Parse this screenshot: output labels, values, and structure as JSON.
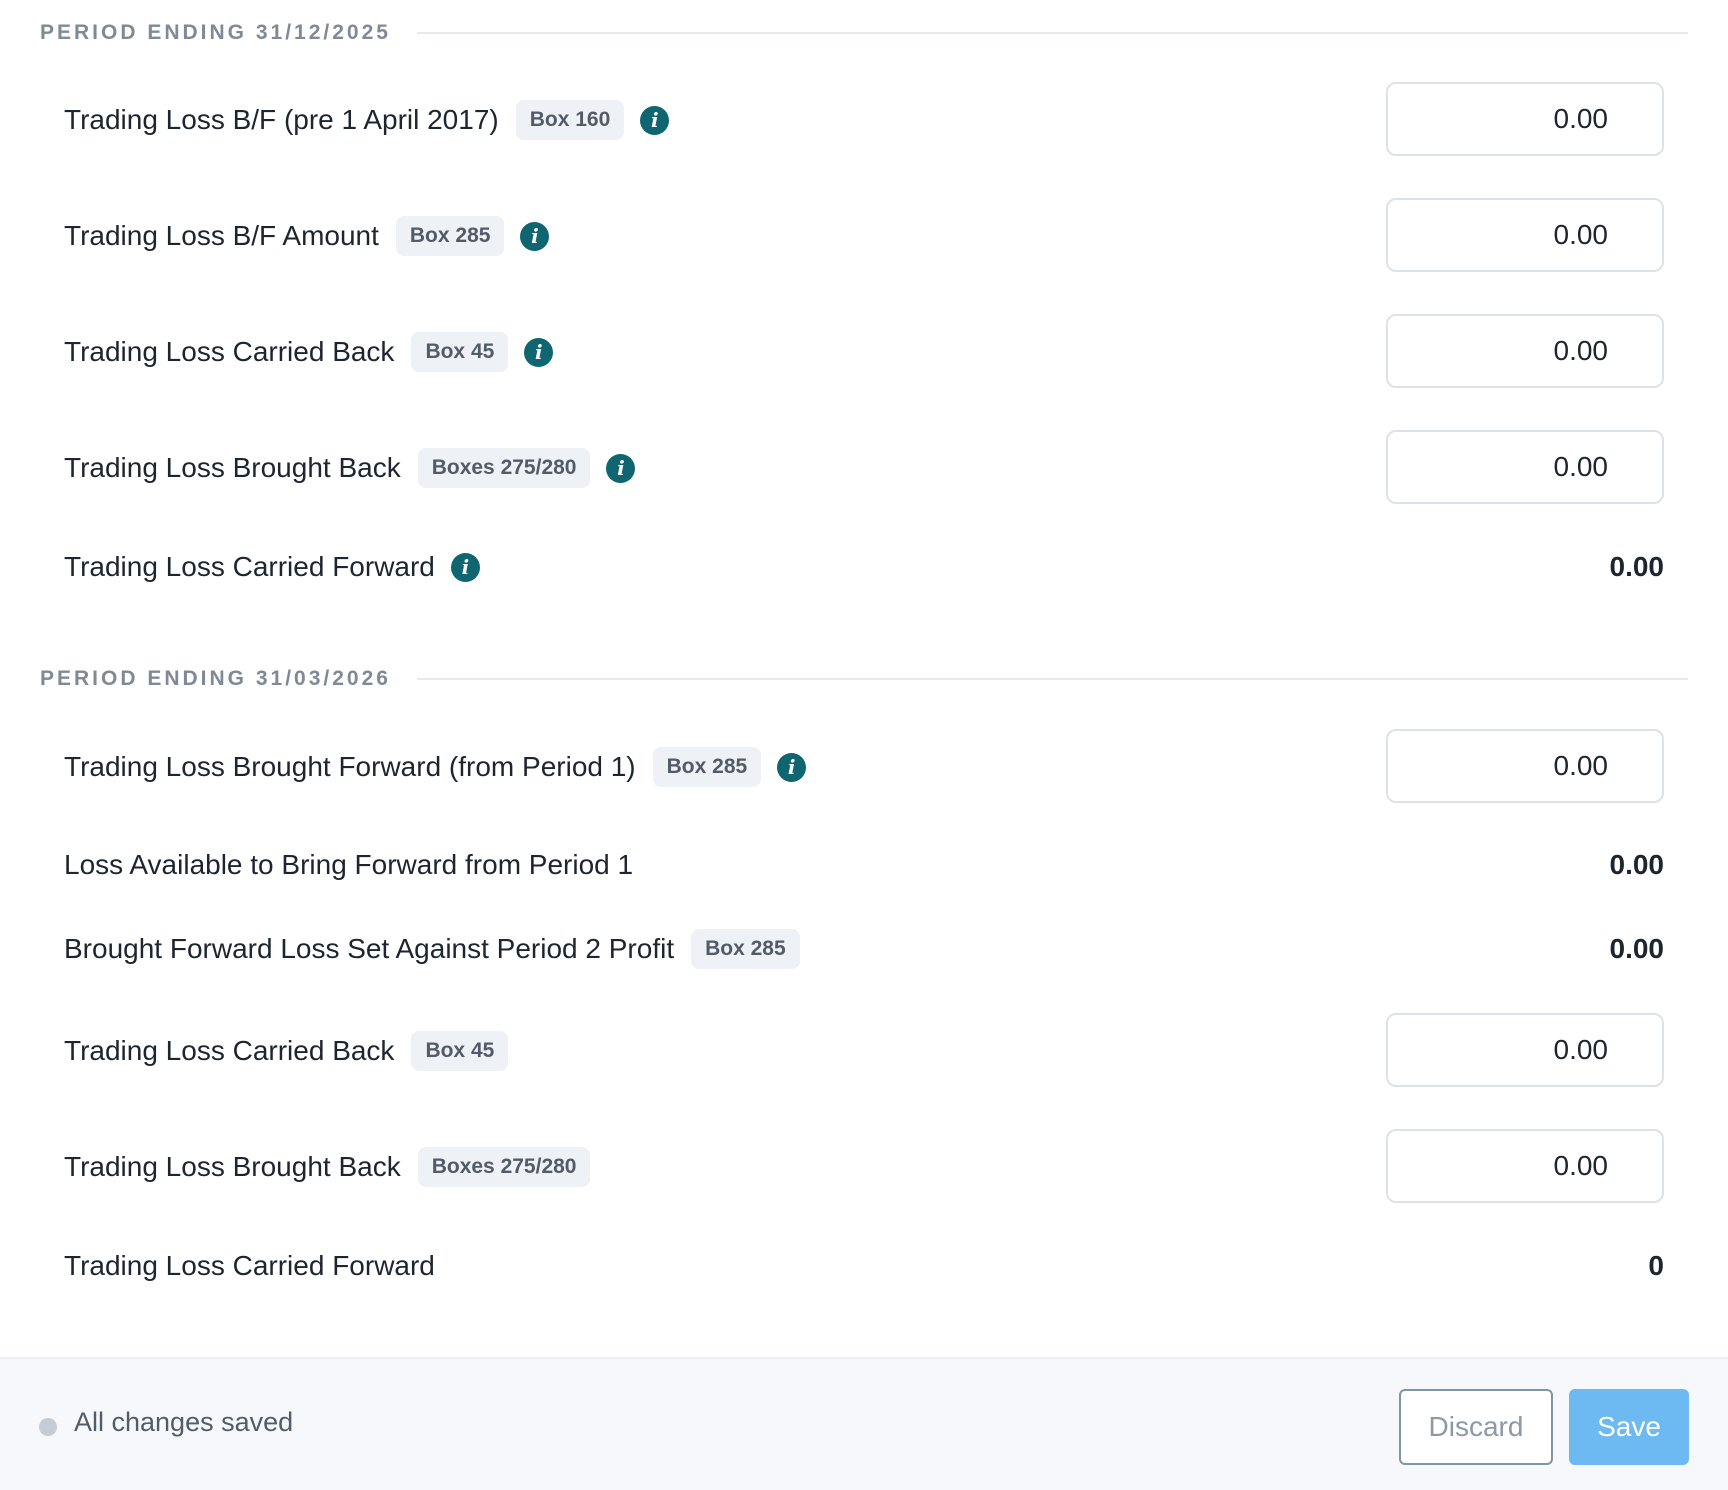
{
  "period1": {
    "title": "PERIOD ENDING 31/12/2025",
    "rows": [
      {
        "label": "Trading Loss B/F (pre 1 April 2017)",
        "badge": "Box 160",
        "value": "0.00"
      },
      {
        "label": "Trading Loss B/F Amount",
        "badge": "Box 285",
        "value": "0.00"
      },
      {
        "label": "Trading Loss Carried Back",
        "badge": "Box 45",
        "value": "0.00"
      },
      {
        "label": "Trading Loss Brought Back",
        "badge": "Boxes 275/280",
        "value": "0.00"
      },
      {
        "label": "Trading Loss Carried Forward",
        "value": "0.00"
      }
    ]
  },
  "period2": {
    "title": "PERIOD ENDING 31/03/2026",
    "rows": [
      {
        "label": "Trading Loss Brought Forward (from Period 1)",
        "badge": "Box 285",
        "value": "0.00"
      },
      {
        "label": "Loss Available to Bring Forward from Period 1",
        "value": "0.00"
      },
      {
        "label": "Brought Forward Loss Set Against Period 2 Profit",
        "badge": "Box 285",
        "value": "0.00"
      },
      {
        "label": "Trading Loss Carried Back",
        "badge": "Box 45",
        "value": "0.00"
      },
      {
        "label": "Trading Loss Brought Back",
        "badge": "Boxes 275/280",
        "value": "0.00"
      },
      {
        "label": "Trading Loss Carried Forward",
        "value": "0"
      }
    ]
  },
  "info_glyph": "i",
  "footer": {
    "status_text": "All changes saved",
    "discard_label": "Discard",
    "save_label": "Save"
  },
  "colors": {
    "info_icon": "#0f6570",
    "save_button": "#6db9f2",
    "badge_bg": "#eef1f5",
    "section_title": "#7f8a96"
  }
}
